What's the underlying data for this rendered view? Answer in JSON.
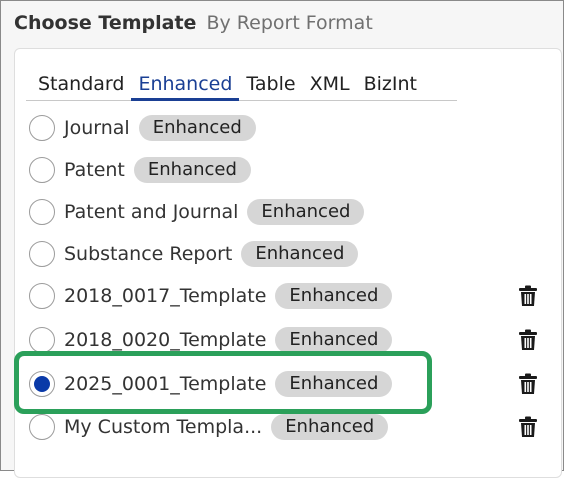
{
  "header": {
    "title": "Choose Template",
    "subtitle": "By Report Format"
  },
  "tabs": [
    {
      "label": "Standard"
    },
    {
      "label": "Enhanced"
    },
    {
      "label": "Table"
    },
    {
      "label": "XML"
    },
    {
      "label": "BizInt"
    }
  ],
  "active_tab": "Enhanced",
  "templates": [
    {
      "label": "Journal",
      "badge": "Enhanced",
      "selected": false,
      "deletable": false
    },
    {
      "label": "Patent",
      "badge": "Enhanced",
      "selected": false,
      "deletable": false
    },
    {
      "label": "Patent and Journal",
      "badge": "Enhanced",
      "selected": false,
      "deletable": false
    },
    {
      "label": "Substance Report",
      "badge": "Enhanced",
      "selected": false,
      "deletable": false
    },
    {
      "label": "2018_0017_Template",
      "badge": "Enhanced",
      "selected": false,
      "deletable": true
    },
    {
      "label": "2018_0020_Template",
      "badge": "Enhanced",
      "selected": false,
      "deletable": true
    },
    {
      "label": "2025_0001_Template",
      "badge": "Enhanced",
      "selected": true,
      "deletable": true
    },
    {
      "label": "My Custom Templa...",
      "badge": "Enhanced",
      "selected": false,
      "deletable": true
    }
  ],
  "colors": {
    "accent": "#1a3f94",
    "selected_radio": "#0a3aa8",
    "badge_bg": "#d6d6d6",
    "highlight": "#2ba05a"
  },
  "icons": {
    "delete": "trash-icon"
  }
}
